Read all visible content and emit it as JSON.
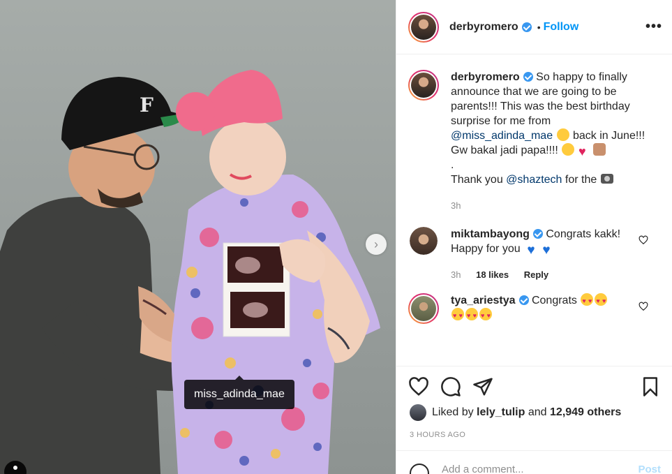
{
  "post": {
    "author": "derbyromero",
    "follow_label": "Follow",
    "separator": "•",
    "more_label": "•••",
    "photo_tag": "miss_adinda_mae"
  },
  "caption": {
    "username": "derbyromero",
    "text_1": "So happy to finally announce that we are going to be parents!!! This was the best birthday surprise for me from",
    "mention_1": "@miss_adinda_mae",
    "text_2": "back in June!!! Gw bakal jadi papa!!!!",
    "dot": ".",
    "text_3": "Thank you",
    "mention_2": "@shaztech",
    "text_4": "for the",
    "time": "3h"
  },
  "comments": [
    {
      "username": "miktambayong",
      "text": "Congrats kakk! Happy for you",
      "time": "3h",
      "likes": "18 likes",
      "reply": "Reply"
    },
    {
      "username": "tya_ariestya",
      "text": "Congrats"
    }
  ],
  "likes": {
    "prefix": "Liked by",
    "user": "lely_tulip",
    "and": "and",
    "others": "12,949 others"
  },
  "timestamp": "3 HOURS AGO",
  "add_comment": {
    "placeholder": "Add a comment...",
    "post_label": "Post"
  },
  "colors": {
    "accent": "#0095f6",
    "verified": "#3897f0",
    "muted": "#8e8e8e",
    "heart": "#e0245e"
  }
}
